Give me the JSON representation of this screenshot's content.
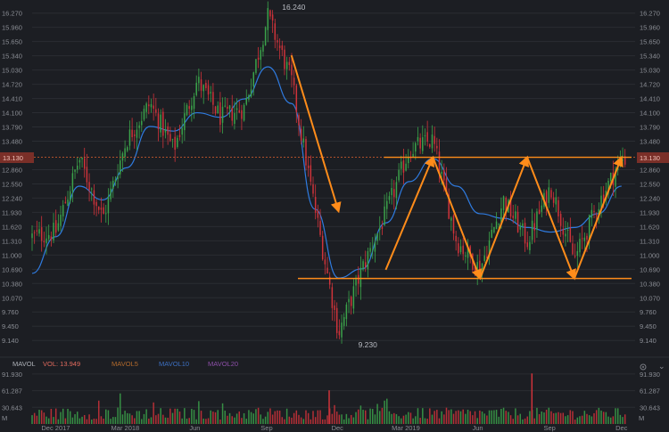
{
  "colors": {
    "background": "#1c1e23",
    "up": "#3ba34a",
    "down": "#d0333a",
    "ma": "#2f7be0",
    "pattern": "#ff8c1a",
    "current_line": "#c6572d",
    "axis_text": "#8a8d94",
    "vol_label": "#e06a5d",
    "mavol5": "#b26a2c",
    "mavol10": "#3c6fc0",
    "mavol20": "#8c4fa8"
  },
  "chart_data": [
    {
      "type": "candlestick",
      "title": "",
      "y_ticks": [
        9.14,
        9.45,
        9.76,
        10.07,
        10.38,
        10.69,
        11.0,
        11.31,
        11.62,
        11.93,
        12.24,
        12.55,
        12.86,
        13.48,
        13.79,
        14.1,
        14.41,
        14.72,
        15.03,
        15.34,
        15.65,
        15.96,
        16.27
      ],
      "y_tick_labels": [
        "9.140",
        "9.450",
        "9.760",
        "10.070",
        "10.380",
        "10.690",
        "11.000",
        "11.310",
        "11.620",
        "11.930",
        "12.240",
        "12.550",
        "12.860",
        "13.480",
        "13.790",
        "14.100",
        "14.410",
        "14.720",
        "15.030",
        "15.340",
        "15.650",
        "15.960",
        "16.270"
      ],
      "ylim": [
        8.95,
        16.4
      ],
      "x_labels": [
        "Dec 2017",
        "Mar 2018",
        "Jun",
        "Sep",
        "Dec",
        "Mar 2019",
        "Jun",
        "Sep",
        "Dec"
      ],
      "current_price": 13.13,
      "current_price_label": "13.130",
      "high_label": "16.240",
      "low_label": "9.230",
      "moving_average": [
        {
          "t": "2017-11",
          "v": 10.6
        },
        {
          "t": "2017-12",
          "v": 11.4
        },
        {
          "t": "2018-01",
          "v": 12.5
        },
        {
          "t": "2018-02",
          "v": 12.2
        },
        {
          "t": "2018-03",
          "v": 12.9
        },
        {
          "t": "2018-04",
          "v": 13.8
        },
        {
          "t": "2018-05",
          "v": 13.7
        },
        {
          "t": "2018-06",
          "v": 14.1
        },
        {
          "t": "2018-07",
          "v": 14.0
        },
        {
          "t": "2018-08",
          "v": 14.4
        },
        {
          "t": "2018-09",
          "v": 15.1
        },
        {
          "t": "2018-10",
          "v": 14.3
        },
        {
          "t": "2018-11",
          "v": 12.0
        },
        {
          "t": "2018-12",
          "v": 10.5
        },
        {
          "t": "2019-01",
          "v": 10.7
        },
        {
          "t": "2019-02",
          "v": 11.7
        },
        {
          "t": "2019-03",
          "v": 12.6
        },
        {
          "t": "2019-04",
          "v": 13.1
        },
        {
          "t": "2019-05",
          "v": 12.5
        },
        {
          "t": "2019-06",
          "v": 11.9
        },
        {
          "t": "2019-07",
          "v": 11.8
        },
        {
          "t": "2019-08",
          "v": 11.6
        },
        {
          "t": "2019-09",
          "v": 11.5
        },
        {
          "t": "2019-10",
          "v": 11.6
        },
        {
          "t": "2019-11",
          "v": 11.9
        },
        {
          "t": "2019-12",
          "v": 12.5
        }
      ],
      "price_path": [
        {
          "t": "2017-11",
          "v": 11.4
        },
        {
          "t": "2017-12",
          "v": 11.5
        },
        {
          "t": "2018-01",
          "v": 13.1
        },
        {
          "t": "2018-02",
          "v": 11.8
        },
        {
          "t": "2018-03",
          "v": 13.5
        },
        {
          "t": "2018-04",
          "v": 14.3
        },
        {
          "t": "2018-05",
          "v": 13.3
        },
        {
          "t": "2018-06",
          "v": 14.8
        },
        {
          "t": "2018-07",
          "v": 14.0
        },
        {
          "t": "2018-08",
          "v": 14.2
        },
        {
          "t": "2018-09",
          "v": 16.2
        },
        {
          "t": "2018-10",
          "v": 14.8
        },
        {
          "t": "2018-11",
          "v": 12.0
        },
        {
          "t": "2018-12",
          "v": 9.3
        },
        {
          "t": "2019-01",
          "v": 10.7
        },
        {
          "t": "2019-02",
          "v": 11.9
        },
        {
          "t": "2019-03",
          "v": 13.3
        },
        {
          "t": "2019-04",
          "v": 13.5
        },
        {
          "t": "2019-05",
          "v": 11.3
        },
        {
          "t": "2019-06",
          "v": 10.7
        },
        {
          "t": "2019-07",
          "v": 12.2
        },
        {
          "t": "2019-08",
          "v": 11.3
        },
        {
          "t": "2019-09",
          "v": 12.5
        },
        {
          "t": "2019-10",
          "v": 10.9
        },
        {
          "t": "2019-11",
          "v": 12.1
        },
        {
          "t": "2019-12",
          "v": 13.1
        }
      ],
      "pattern": {
        "resistance": 13.13,
        "support": 10.49,
        "zigzag": [
          {
            "t": "2019-02",
            "v": 10.68
          },
          {
            "t": "2019-04",
            "v": 13.13
          },
          {
            "t": "2019-06",
            "v": 10.49
          },
          {
            "t": "2019-08",
            "v": 13.13
          },
          {
            "t": "2019-10",
            "v": 10.49
          },
          {
            "t": "2019-12",
            "v": 13.13
          }
        ],
        "decline_arrow": [
          {
            "t": "2018-10",
            "v": 15.35
          },
          {
            "t": "2018-12",
            "v": 11.95
          }
        ]
      }
    },
    {
      "type": "bar",
      "title": "",
      "indicator_label": "MAVOL",
      "vol_label": "VOL: 13.949",
      "legend": [
        "MAVOL5",
        "MAVOL10",
        "MAVOL20"
      ],
      "y_ticks": [
        30.643,
        61.287,
        91.93
      ],
      "y_tick_labels": [
        "30.643",
        "61.287",
        "91.930"
      ],
      "unit_label": "M",
      "ylim": [
        0,
        100
      ]
    }
  ]
}
